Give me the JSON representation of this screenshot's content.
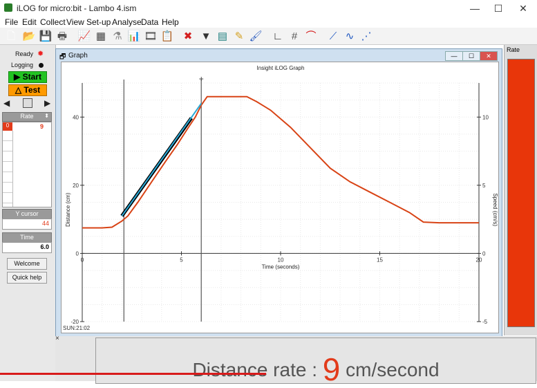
{
  "window": {
    "title": "iLOG for micro:bit - Lambo 4.ism",
    "minimize": "—",
    "maximize": "☐",
    "close": "✕"
  },
  "menu": [
    "File",
    "Edit",
    "Collect",
    "View",
    "Set-up",
    "Analyse",
    "Data",
    "Help"
  ],
  "toolbar": [
    {
      "name": "new-icon",
      "glyph": "🗋",
      "color": "#ffffff"
    },
    {
      "name": "open-icon",
      "glyph": "📂",
      "color": "#e8b13a"
    },
    {
      "name": "save-icon",
      "glyph": "💾",
      "color": "#2b5fa8"
    },
    {
      "name": "print-icon",
      "glyph": "🖶",
      "color": "#555555"
    },
    {
      "name": "graph-icon",
      "glyph": "📈",
      "color": "#3a8a3a"
    },
    {
      "name": "table-icon",
      "glyph": "▦",
      "color": "#444444"
    },
    {
      "name": "flask-icon",
      "glyph": "⚗",
      "color": "#888888"
    },
    {
      "name": "bar-chart-icon",
      "glyph": "📊",
      "color": "#2f6fd0"
    },
    {
      "name": "film-icon",
      "glyph": "🎞",
      "color": "#444444"
    },
    {
      "name": "report-icon",
      "glyph": "📋",
      "color": "#444444"
    },
    {
      "name": "delete-icon",
      "glyph": "✖",
      "color": "#d42020"
    },
    {
      "name": "filter-icon",
      "glyph": "▼",
      "color": "#333333"
    },
    {
      "name": "layout-icon",
      "glyph": "▤",
      "color": "#1e7f7f"
    },
    {
      "name": "pencil-icon",
      "glyph": "✎",
      "color": "#d4a020"
    },
    {
      "name": "brush-icon",
      "glyph": "🖌",
      "color": "#3060c0"
    },
    {
      "name": "axes-icon",
      "glyph": "∟",
      "color": "#222222"
    },
    {
      "name": "grid-icon",
      "glyph": "#",
      "color": "#555555"
    },
    {
      "name": "curve-icon",
      "glyph": "⌒",
      "color": "#d42020"
    },
    {
      "name": "line-fit-icon",
      "glyph": "⟋",
      "color": "#1f57c0"
    },
    {
      "name": "curve-fit-icon",
      "glyph": "∿",
      "color": "#1f57c0"
    },
    {
      "name": "scatter-fit-icon",
      "glyph": "⋰",
      "color": "#1f57c0"
    }
  ],
  "left": {
    "ready": "Ready",
    "logging": "Logging",
    "start": "▶ Start",
    "test": "△ Test",
    "rate_header": "Rate",
    "rate_value": "9",
    "rate_channel": "0",
    "ycursor_label": "Y cursor",
    "ycursor_value": "44",
    "time_label": "Time",
    "time_value": "6.0",
    "welcome": "Welcome",
    "quickhelp": "Quick help"
  },
  "graph_window": {
    "title": "Graph",
    "status": "SUN:21:02"
  },
  "right": {
    "rate_label": "Rate",
    "rate_value_cm_s": 9
  },
  "caption": {
    "prefix": "Distance rate : ",
    "value": "9",
    "unit": " cm/second"
  },
  "colors": {
    "series": "#d84315",
    "fit_line": "#000000",
    "tangent": "#2aa9d6",
    "start": "#22c322",
    "test": "#ff9a00",
    "rate_bar": "#e8360a"
  },
  "chart_data": {
    "type": "line",
    "title": "Insight iLOG Graph",
    "xlabel": "Time (seconds)",
    "ylabel": "Distance (cm)",
    "y2label": "Speed (cm/s)",
    "xlim": [
      0,
      20
    ],
    "ylim": [
      -20,
      50
    ],
    "y2lim": [
      -5,
      12.5
    ],
    "xticks": [
      0,
      5,
      10,
      15,
      20
    ],
    "yticks": [
      -20,
      0,
      20,
      40
    ],
    "y2ticks": [
      -5,
      0,
      5,
      10
    ],
    "grid": true,
    "cursors_x": [
      2.1,
      6.0
    ],
    "series": [
      {
        "name": "Distance",
        "points": [
          [
            0,
            7.5
          ],
          [
            1.0,
            7.5
          ],
          [
            1.5,
            7.7
          ],
          [
            2.0,
            9.5
          ],
          [
            2.3,
            11
          ],
          [
            2.8,
            15
          ],
          [
            3.5,
            21
          ],
          [
            4.2,
            27
          ],
          [
            4.8,
            32
          ],
          [
            5.3,
            36.5
          ],
          [
            5.7,
            40
          ],
          [
            6.0,
            43.5
          ],
          [
            6.3,
            46
          ],
          [
            8.3,
            46
          ],
          [
            8.8,
            44.5
          ],
          [
            9.5,
            42
          ],
          [
            10.5,
            37
          ],
          [
            11.5,
            31
          ],
          [
            12.5,
            25
          ],
          [
            13.5,
            21
          ],
          [
            14.5,
            18
          ],
          [
            15.5,
            15
          ],
          [
            16.5,
            12
          ],
          [
            17.2,
            9.2
          ],
          [
            18.0,
            9.0
          ],
          [
            20,
            9.0
          ]
        ]
      }
    ],
    "fit": {
      "type": "line",
      "x": [
        2.0,
        6.0
      ],
      "y": [
        11,
        44
      ],
      "color": "#000000"
    },
    "tangent": {
      "x": [
        2.0,
        6.0
      ],
      "y": [
        11,
        44
      ],
      "color": "#2aa9d6"
    }
  }
}
